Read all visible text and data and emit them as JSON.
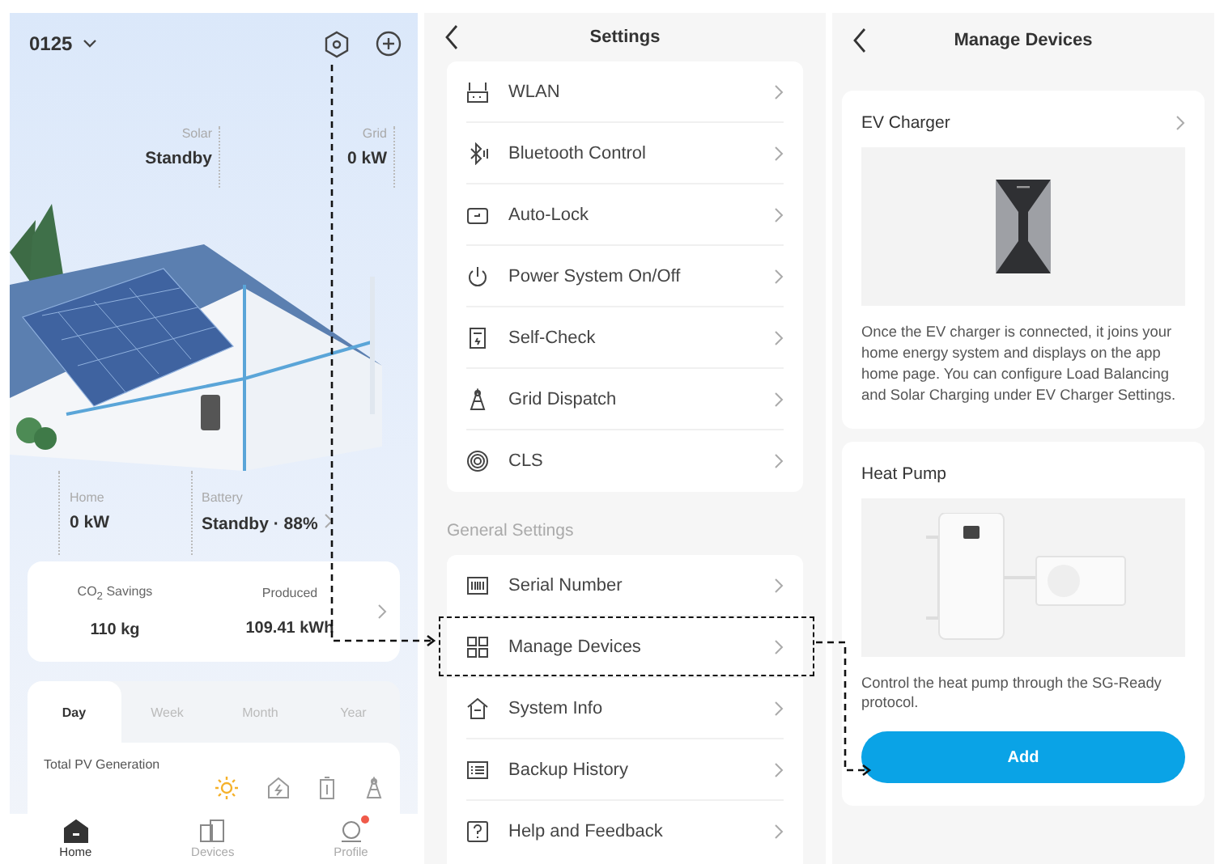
{
  "home": {
    "site": "0125",
    "flows": [
      {
        "label": "Solar",
        "value": "Standby"
      },
      {
        "label": "Grid",
        "value": "0 kW"
      },
      {
        "label": "Home",
        "value": "0 kW"
      },
      {
        "label": "Battery",
        "value": "Standby · 88%"
      }
    ],
    "stats": [
      {
        "label": "CO$_{2}$ Savings",
        "value": "110 kg"
      },
      {
        "label": "Produced",
        "value": "109.41 kWh"
      }
    ],
    "tabs": [
      {
        "label": "Day",
        "selected": true
      },
      {
        "label": "Week",
        "selected": false
      },
      {
        "label": "Month",
        "selected": false
      },
      {
        "label": "Year",
        "selected": false
      }
    ],
    "chart_title": "Total PV Generation",
    "nav": [
      {
        "label": "Home",
        "selected": true,
        "badge": false
      },
      {
        "label": "Devices",
        "selected": false,
        "badge": false
      },
      {
        "label": "Profile",
        "selected": false,
        "badge": true
      }
    ]
  },
  "settings": {
    "title": "Settings",
    "items": [
      {
        "label": "WLAN"
      },
      {
        "label": "Bluetooth Control"
      },
      {
        "label": "Auto-Lock"
      },
      {
        "label": "Power System On/Off"
      },
      {
        "label": "Self-Check"
      },
      {
        "label": "Grid Dispatch"
      },
      {
        "label": "CLS"
      }
    ],
    "section": "General Settings",
    "general_items": [
      {
        "label": "Serial Number",
        "highlighted": false
      },
      {
        "label": "Manage Devices",
        "highlighted": true
      },
      {
        "label": "System Info",
        "highlighted": false
      },
      {
        "label": "Backup History",
        "highlighted": false
      },
      {
        "label": "Help and Feedback",
        "highlighted": false
      }
    ]
  },
  "devices": {
    "title": "Manage Devices",
    "cards": [
      {
        "kind": "ev",
        "title": "EV Charger",
        "text": "Once the EV charger is connected, it joins your home energy system and displays on the app home page. You can configure Load Balancing and Solar Charging under EV Charger Settings."
      },
      {
        "kind": "pump",
        "title": "Heat Pump",
        "text": "Control the heat pump through the SG-Ready protocol.",
        "button": "Add"
      }
    ]
  }
}
